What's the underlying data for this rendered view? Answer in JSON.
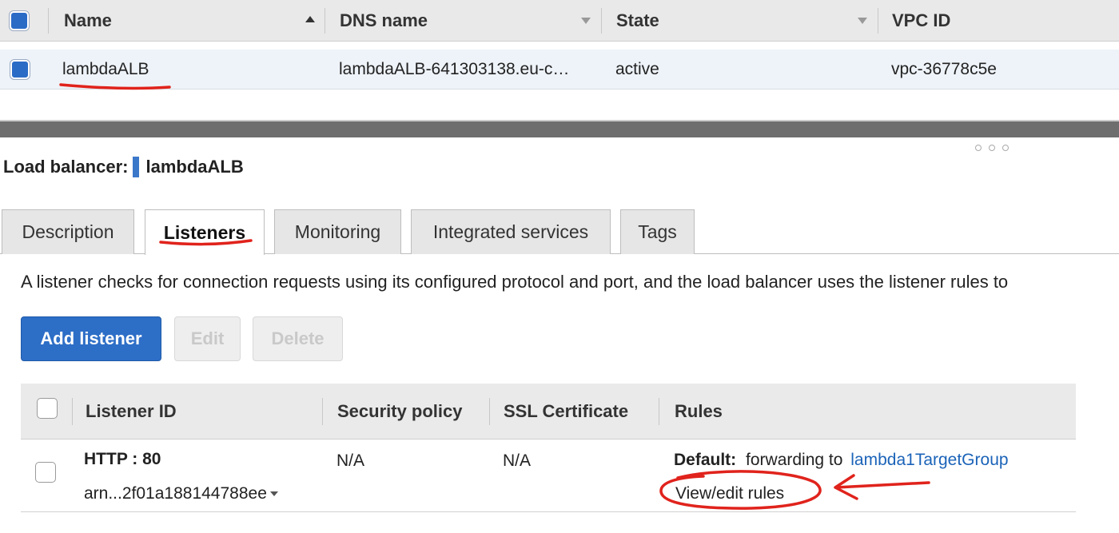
{
  "load_balancers_table": {
    "columns": [
      "Name",
      "DNS name",
      "State",
      "VPC ID"
    ],
    "rows": [
      {
        "name": "lambdaALB",
        "dns_name": "lambdaALB-641303138.eu-c…",
        "state": "active",
        "vpc_id": "vpc-36778c5e"
      }
    ]
  },
  "details": {
    "title_label": "Load balancer:",
    "title_value": "lambdaALB",
    "tabs": [
      {
        "label": "Description"
      },
      {
        "label": "Listeners",
        "active": true
      },
      {
        "label": "Monitoring"
      },
      {
        "label": "Integrated services"
      },
      {
        "label": "Tags"
      }
    ],
    "info_text": "A listener checks for connection requests using its configured protocol and port, and the load balancer uses the listener rules to",
    "buttons": {
      "add": "Add listener",
      "edit": "Edit",
      "delete": "Delete"
    }
  },
  "listeners_table": {
    "columns": [
      "Listener ID",
      "Security policy",
      "SSL Certificate",
      "Rules"
    ],
    "rows": [
      {
        "protocol_port": "HTTP : 80",
        "arn": "arn...2f01a188144788ee",
        "security_policy": "N/A",
        "ssl_certificate": "N/A",
        "default_label": "Default:",
        "forwarding_text": "forwarding to",
        "target_group": "lambda1TargetGroup",
        "view_edit_rules": "View/edit rules"
      }
    ]
  },
  "colors": {
    "primary_button": "#2d6ec7",
    "link": "#1b63b8",
    "checkbox_checked": "#2a6bc6",
    "annotation_red": "#e0231c"
  }
}
